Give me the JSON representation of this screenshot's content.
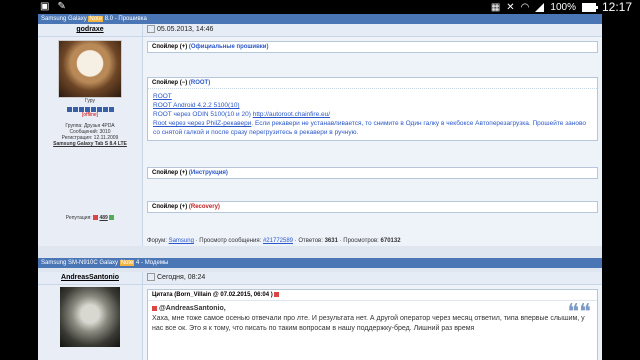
{
  "statusbar": {
    "battery": "100%",
    "time": "12:17",
    "battery_level": 1.0
  },
  "thread1": {
    "bar_prefix": "Samsung Galaxy ",
    "bar_tag": "Note",
    "bar_suffix": " 8.0 - Прошивка"
  },
  "post1": {
    "author": "godraxe",
    "date": "05.05.2013, 14:46",
    "rank": "Гуру",
    "status": "[offline]",
    "group": "Группа: Друзья 4PDA",
    "messages": "Сообщений: 3010",
    "registered": "Регистрация: 12.11.2009",
    "device": "Samsung Galaxy Tab S 8.4 LTE",
    "reputation_label": "Репутация:",
    "reputation_value": "489",
    "spoiler1_label": "Спойлер (+)",
    "spoiler1_title": "(Официальные прошивки)",
    "spoiler2_label": "Спойлер (−)",
    "spoiler2_title": "(ROOT)",
    "line1": "ROOT",
    "line2": "ROOT Android 4.2.2 5100(10)",
    "line3a": "ROOT через ODIN 5100(10 и 20)",
    "line3b": "http://autoroot.chainfire.eu/",
    "line4a": "Root через через PhilZ-рекавери",
    "line4b": ". Если рекавери не устанавливается, то снимите в Один галку в чекбоксе Автоперезагрузка. Прошейте заново со снятой галкой и после сразу перегрузитесь в рекавери в ручную.",
    "spoiler3_label": "Спойлер (+)",
    "spoiler3_title": "(Инструкция)",
    "spoiler4_label": "Спойлер (+)",
    "spoiler4_title": "(Recovery)",
    "footer_forum_label": "Форум: ",
    "footer_forum": "Samsung",
    "footer_msg_label": " · Просмотр сообщения: ",
    "footer_msg": "#21772589",
    "footer_answers_label": " · Ответов: ",
    "footer_answers": "3631",
    "footer_views_label": " · Просмотров: ",
    "footer_views": "670132"
  },
  "thread2": {
    "bar_prefix": "Samsung SM-N910C Galaxy ",
    "bar_tag": "Note",
    "bar_suffix": " 4 - Модемы"
  },
  "post2": {
    "author": "AndreasSantonio",
    "date": "Сегодня, 08:24",
    "quote_head": "Цитата (Born_Villain @ 07.02.2015, 06:04 )",
    "reply_to": "@AndreasSantonio,",
    "text": "Хаха, мне тоже самое осенью отвечали про лте. И результата нет. А другой оператор через месяц ответил, типа впервые слышим, у нас все ок. Это я к тому, что писать по таким вопросам в нашу поддержку-бред. Лишний раз время"
  }
}
